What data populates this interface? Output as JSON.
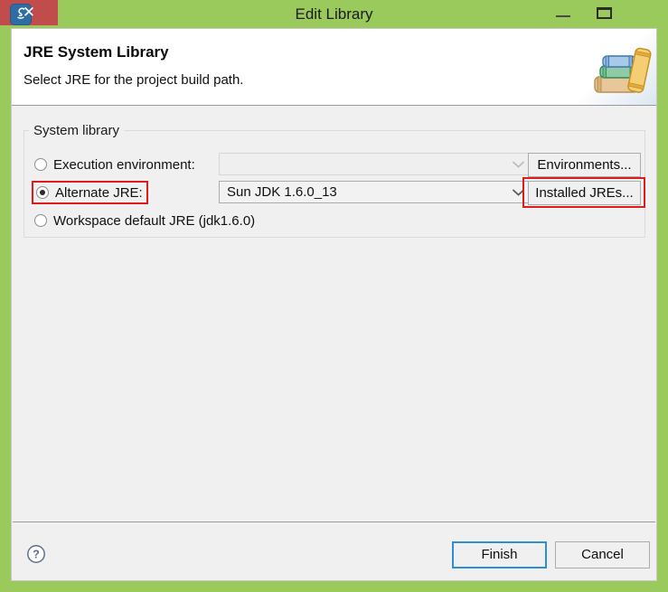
{
  "window": {
    "title": "Edit Library",
    "app_icon": "eclipse-java-icon",
    "controls": {
      "minimize_label": "Minimize",
      "maximize_label": "Maximize",
      "close_label": "✕"
    },
    "titlebar_color": "#9ACA5C",
    "close_color": "#C14C4C"
  },
  "header": {
    "title": "JRE System Library",
    "description": "Select JRE for the project build path.",
    "art_icon": "books-stack-icon"
  },
  "group": {
    "legend": "System library",
    "options": [
      {
        "id": "execution-environment",
        "label": "Execution environment:",
        "selected": false,
        "combo": {
          "value": "",
          "disabled": true,
          "arrow_icon": "chevron-down-icon"
        },
        "button": {
          "label": "Environments...",
          "highlighted": false
        }
      },
      {
        "id": "alternate-jre",
        "label": "Alternate JRE:",
        "selected": true,
        "highlighted": true,
        "combo": {
          "value": "Sun JDK 1.6.0_13",
          "disabled": false,
          "arrow_icon": "chevron-down-icon"
        },
        "button": {
          "label": "Installed JREs...",
          "highlighted": true
        }
      },
      {
        "id": "workspace-default-jre",
        "label": "Workspace default JRE (jdk1.6.0)",
        "selected": false
      }
    ]
  },
  "footer": {
    "help_icon": "help-question-icon",
    "finish_label": "Finish",
    "cancel_label": "Cancel",
    "default_button": "Finish"
  },
  "colors": {
    "accent_green": "#9ACA5C",
    "highlight_red": "#E01B1B",
    "focus_blue": "#2E8FD8",
    "close_red": "#C14C4C"
  }
}
